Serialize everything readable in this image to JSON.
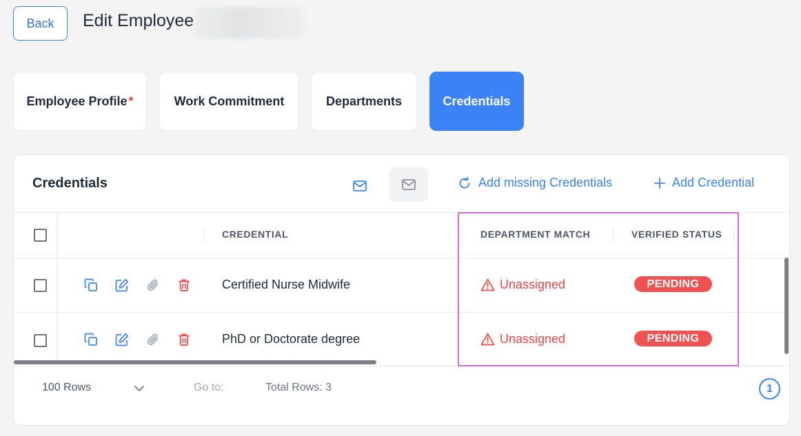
{
  "header": {
    "back_label": "Back",
    "title": "Edit Employee"
  },
  "tabs": [
    {
      "label": "Employee Profile",
      "required_mark": "*",
      "active": false
    },
    {
      "label": "Work Commitment",
      "active": false
    },
    {
      "label": "Departments",
      "active": false
    },
    {
      "label": "Credentials",
      "active": true
    }
  ],
  "card": {
    "title": "Credentials",
    "mail_icon": "mail-icon",
    "refresh_icon": "refresh-icon",
    "add_missing_label": "Add missing Credentials",
    "add_icon": "plus-icon",
    "add_label": "Add Credential"
  },
  "table": {
    "columns": [
      "CREDENTIAL",
      "DEPARTMENT MATCH",
      "VERIFIED STATUS"
    ],
    "rows": [
      {
        "credential": "Certified Nurse Midwife",
        "department_match": "Unassigned",
        "verified_status": "PENDING"
      },
      {
        "credential": "PhD or Doctorate degree",
        "department_match": "Unassigned",
        "verified_status": "PENDING"
      }
    ],
    "action_icons": [
      "copy-icon",
      "edit-icon",
      "paperclip-icon",
      "trash-icon"
    ]
  },
  "footer": {
    "rows_per_page": "100 Rows",
    "goto_label": "Go to:",
    "total_rows": "Total Rows: 3",
    "current_page": "1"
  },
  "colors": {
    "accent": "#3b82f6",
    "danger": "#ef4444",
    "highlight": "#d36ad6"
  }
}
